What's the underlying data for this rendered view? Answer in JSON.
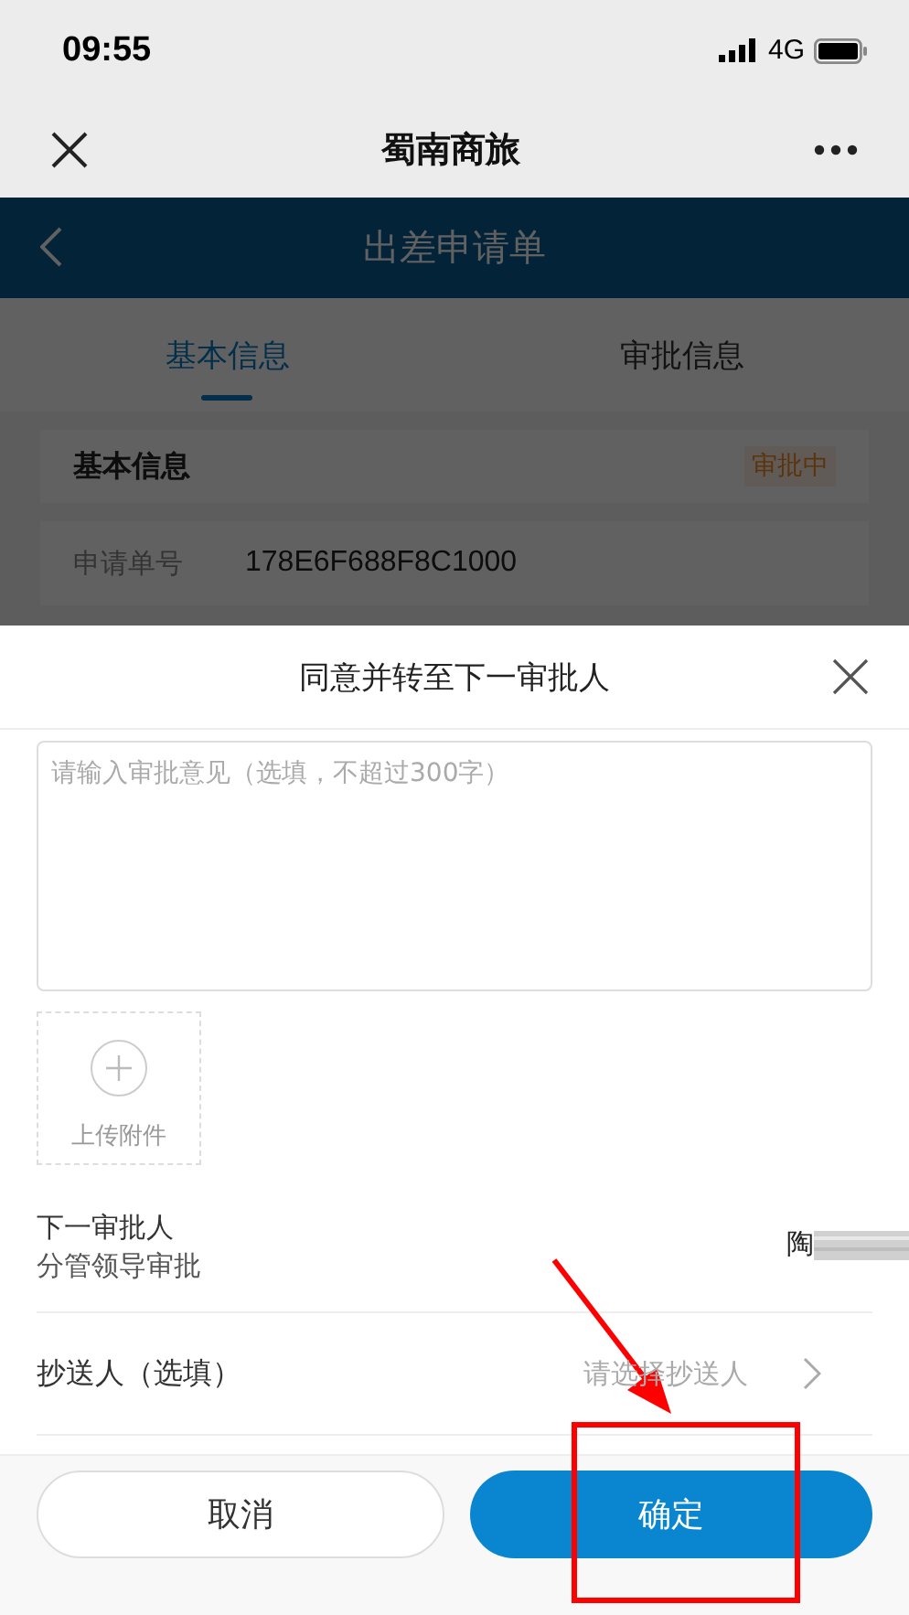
{
  "status_bar": {
    "time": "09:55",
    "network": "4G"
  },
  "nav_bar": {
    "title": "蜀南商旅"
  },
  "page": {
    "header_title": "出差申请单",
    "tabs": [
      {
        "label": "基本信息",
        "selected": true
      },
      {
        "label": "审批信息",
        "selected": false
      }
    ],
    "card": {
      "title": "基本信息",
      "status": "审批中",
      "fields": [
        {
          "label": "申请单号",
          "value": "178E6F688F8C1000"
        }
      ]
    }
  },
  "sheet": {
    "title": "同意并转至下一审批人",
    "comment": {
      "placeholder": "请输入审批意见（选填，不超过300字）"
    },
    "upload": {
      "label": "上传附件"
    },
    "approver": {
      "label": "下一审批人",
      "sublabel": "分管领导审批",
      "name": "陶"
    },
    "cc": {
      "label": "抄送人（选填）",
      "placeholder": "请选择抄送人"
    },
    "buttons": {
      "cancel": "取消",
      "confirm": "确定"
    }
  }
}
